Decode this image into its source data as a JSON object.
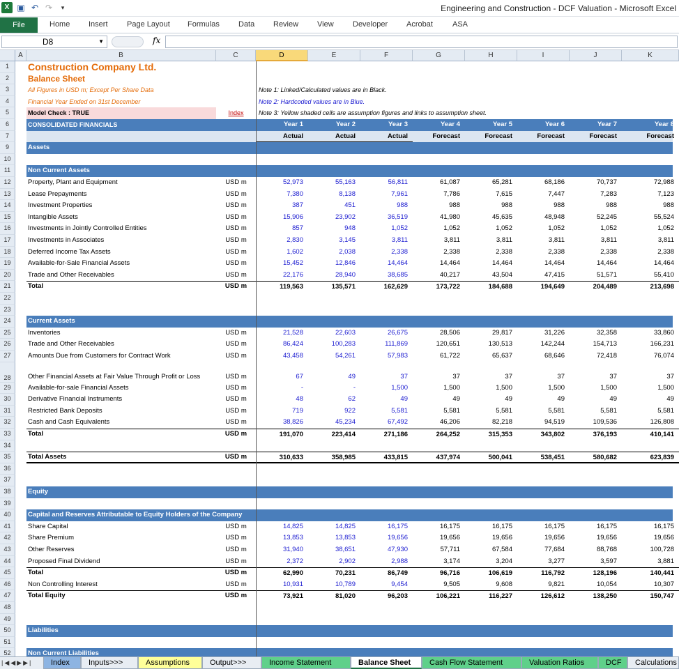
{
  "window": {
    "title": "Engineering and Construction - DCF Valuation - Microsoft Excel"
  },
  "ribbon": {
    "file": "File",
    "tabs": [
      "Home",
      "Insert",
      "Page Layout",
      "Formulas",
      "Data",
      "Review",
      "View",
      "Developer",
      "Acrobat",
      "ASA"
    ]
  },
  "formula_bar": {
    "name_box": "D8",
    "fx": "fx",
    "content": ""
  },
  "columns": [
    "A",
    "B",
    "C",
    "D",
    "E",
    "F",
    "G",
    "H",
    "I",
    "J",
    "K"
  ],
  "selected_column": "D",
  "rows": [
    {
      "n": "1",
      "type": "title",
      "b": "Construction Company Ltd."
    },
    {
      "n": "2",
      "type": "subtitle",
      "b": "Balance Sheet"
    },
    {
      "n": "3",
      "type": "note",
      "b": "All Figures in USD m; Except Per Share Data",
      "note": "Note 1: Linked/Calculated values are in Black."
    },
    {
      "n": "4",
      "type": "note2",
      "b": "Financial Year Ended on 31st December",
      "note": "Note 2: Hardcoded values are in Blue."
    },
    {
      "n": "5",
      "type": "check",
      "b": "Model Check : TRUE",
      "c": "Index",
      "note": "Note 3: Yellow shaded cells are assumption figures and links to assumption sheet."
    },
    {
      "n": "6",
      "type": "header",
      "b": "CONSOLIDATED FINANCIALS",
      "vals": [
        "Year 1",
        "Year 2",
        "Year 3",
        "Year 4",
        "Year 5",
        "Year 6",
        "Year 7",
        "Year 8"
      ]
    },
    {
      "n": "7",
      "type": "subheader",
      "vals": [
        "Actual",
        "Actual",
        "Actual",
        "Forecast",
        "Forecast",
        "Forecast",
        "Forecast",
        "Forecast"
      ]
    },
    {
      "n": "9",
      "type": "section",
      "b": "Assets"
    },
    {
      "n": "10",
      "type": "blank"
    },
    {
      "n": "11",
      "type": "section",
      "b": "Non Current Assets"
    },
    {
      "n": "12",
      "type": "data",
      "b": "Property, Plant and Equipment",
      "c": "USD m",
      "vals": [
        "52,973",
        "55,163",
        "56,811",
        "61,087",
        "65,281",
        "68,186",
        "70,737",
        "72,988"
      ]
    },
    {
      "n": "13",
      "type": "data",
      "b": "Lease Prepayments",
      "c": "USD m",
      "vals": [
        "7,380",
        "8,138",
        "7,961",
        "7,786",
        "7,615",
        "7,447",
        "7,283",
        "7,123"
      ]
    },
    {
      "n": "14",
      "type": "data",
      "b": "Investment Properties",
      "c": "USD m",
      "vals": [
        "387",
        "451",
        "988",
        "988",
        "988",
        "988",
        "988",
        "988"
      ]
    },
    {
      "n": "15",
      "type": "data",
      "b": "Intangible Assets",
      "c": "USD m",
      "vals": [
        "15,906",
        "23,902",
        "36,519",
        "41,980",
        "45,635",
        "48,948",
        "52,245",
        "55,524"
      ]
    },
    {
      "n": "16",
      "type": "data",
      "b": "Investments in Jointly Controlled Entities",
      "c": "USD m",
      "vals": [
        "857",
        "948",
        "1,052",
        "1,052",
        "1,052",
        "1,052",
        "1,052",
        "1,052"
      ]
    },
    {
      "n": "17",
      "type": "data",
      "b": "Investments in Associates",
      "c": "USD m",
      "vals": [
        "2,830",
        "3,145",
        "3,811",
        "3,811",
        "3,811",
        "3,811",
        "3,811",
        "3,811"
      ]
    },
    {
      "n": "18",
      "type": "data",
      "b": "Deferred Income Tax Assets",
      "c": "USD m",
      "vals": [
        "1,602",
        "2,038",
        "2,338",
        "2,338",
        "2,338",
        "2,338",
        "2,338",
        "2,338"
      ]
    },
    {
      "n": "19",
      "type": "data",
      "b": "Available-for-Sale Financial Assets",
      "c": "USD m",
      "vals": [
        "15,452",
        "12,846",
        "14,464",
        "14,464",
        "14,464",
        "14,464",
        "14,464",
        "14,464"
      ]
    },
    {
      "n": "20",
      "type": "data",
      "b": "Trade and Other Receivables",
      "c": "USD m",
      "vals": [
        "22,176",
        "28,940",
        "38,685",
        "40,217",
        "43,504",
        "47,415",
        "51,571",
        "55,410"
      ]
    },
    {
      "n": "21",
      "type": "total",
      "b": "Total",
      "c": "USD m",
      "vals": [
        "119,563",
        "135,571",
        "162,629",
        "173,722",
        "184,688",
        "194,649",
        "204,489",
        "213,698"
      ]
    },
    {
      "n": "22",
      "type": "blank"
    },
    {
      "n": "23",
      "type": "blank"
    },
    {
      "n": "24",
      "type": "section",
      "b": "Current Assets"
    },
    {
      "n": "25",
      "type": "data",
      "b": "Inventories",
      "c": "USD m",
      "vals": [
        "21,528",
        "22,603",
        "26,675",
        "28,506",
        "29,817",
        "31,226",
        "32,358",
        "33,860"
      ]
    },
    {
      "n": "26",
      "type": "data",
      "b": "Trade and Other Receivables",
      "c": "USD m",
      "vals": [
        "86,424",
        "100,283",
        "111,869",
        "120,651",
        "130,513",
        "142,244",
        "154,713",
        "166,231"
      ]
    },
    {
      "n": "27",
      "type": "data",
      "b": "Amounts Due from Customers for Contract Work",
      "c": "USD m",
      "vals": [
        "43,458",
        "54,261",
        "57,983",
        "61,722",
        "65,637",
        "68,646",
        "72,418",
        "76,074"
      ]
    },
    {
      "n": "28",
      "type": "data",
      "tall": true,
      "b": "Other Financial Assets at Fair Value Through Profit or Loss",
      "c": "USD m",
      "vals": [
        "67",
        "49",
        "37",
        "37",
        "37",
        "37",
        "37",
        "37"
      ]
    },
    {
      "n": "29",
      "type": "data",
      "b": "Available-for-sale Financial Assets",
      "c": "USD m",
      "vals": [
        "-",
        "-",
        "1,500",
        "1,500",
        "1,500",
        "1,500",
        "1,500",
        "1,500"
      ]
    },
    {
      "n": "30",
      "type": "data",
      "b": "Derivative Financial Instruments",
      "c": "USD m",
      "vals": [
        "48",
        "62",
        "49",
        "49",
        "49",
        "49",
        "49",
        "49"
      ]
    },
    {
      "n": "31",
      "type": "data",
      "b": "Restricted Bank Deposits",
      "c": "USD m",
      "vals": [
        "719",
        "922",
        "5,581",
        "5,581",
        "5,581",
        "5,581",
        "5,581",
        "5,581"
      ]
    },
    {
      "n": "32",
      "type": "data",
      "b": "Cash and Cash Equivalents",
      "c": "USD m",
      "vals": [
        "38,826",
        "45,234",
        "67,492",
        "46,206",
        "82,218",
        "94,519",
        "109,536",
        "126,808"
      ]
    },
    {
      "n": "33",
      "type": "total",
      "b": "Total",
      "c": "USD m",
      "vals": [
        "191,070",
        "223,414",
        "271,186",
        "264,252",
        "315,353",
        "343,802",
        "376,193",
        "410,141"
      ]
    },
    {
      "n": "34",
      "type": "blank"
    },
    {
      "n": "35",
      "type": "grand",
      "b": "Total Assets",
      "c": "USD m",
      "vals": [
        "310,633",
        "358,985",
        "433,815",
        "437,974",
        "500,041",
        "538,451",
        "580,682",
        "623,839"
      ]
    },
    {
      "n": "36",
      "type": "blank"
    },
    {
      "n": "37",
      "type": "blank"
    },
    {
      "n": "38",
      "type": "section",
      "b": "Equity"
    },
    {
      "n": "39",
      "type": "blank"
    },
    {
      "n": "40",
      "type": "section",
      "b": "Capital and Reserves Attributable to Equity Holders of the Company"
    },
    {
      "n": "41",
      "type": "data",
      "b": "Share Capital",
      "c": "USD m",
      "vals": [
        "14,825",
        "14,825",
        "16,175",
        "16,175",
        "16,175",
        "16,175",
        "16,175",
        "16,175"
      ]
    },
    {
      "n": "42",
      "type": "data",
      "b": "Share Premium",
      "c": "USD m",
      "vals": [
        "13,853",
        "13,853",
        "19,656",
        "19,656",
        "19,656",
        "19,656",
        "19,656",
        "19,656"
      ]
    },
    {
      "n": "43",
      "type": "data",
      "b": "Other Reserves",
      "c": "USD m",
      "vals": [
        "31,940",
        "38,651",
        "47,930",
        "57,711",
        "67,584",
        "77,684",
        "88,768",
        "100,728"
      ]
    },
    {
      "n": "44",
      "type": "data",
      "b": "Proposed Final Dividend",
      "c": "USD m",
      "vals": [
        "2,372",
        "2,902",
        "2,988",
        "3,174",
        "3,204",
        "3,277",
        "3,597",
        "3,881"
      ]
    },
    {
      "n": "45",
      "type": "total",
      "b": "Total",
      "c": "USD m",
      "vals": [
        "62,990",
        "70,231",
        "86,749",
        "96,716",
        "106,619",
        "116,792",
        "128,196",
        "140,441"
      ]
    },
    {
      "n": "46",
      "type": "data",
      "b": "Non Controlling Interest",
      "c": "USD m",
      "vals": [
        "10,931",
        "10,789",
        "9,454",
        "9,505",
        "9,608",
        "9,821",
        "10,054",
        "10,307"
      ]
    },
    {
      "n": "47",
      "type": "total",
      "b": "Total Equity",
      "c": "USD m",
      "vals": [
        "73,921",
        "81,020",
        "96,203",
        "106,221",
        "116,227",
        "126,612",
        "138,250",
        "150,747"
      ]
    },
    {
      "n": "48",
      "type": "blank"
    },
    {
      "n": "49",
      "type": "blank"
    },
    {
      "n": "50",
      "type": "section",
      "b": "Liabilities"
    },
    {
      "n": "51",
      "type": "blank"
    },
    {
      "n": "52",
      "type": "section",
      "b": "Non Current Liabilities"
    }
  ],
  "sheet_tabs": [
    {
      "label": "Index",
      "bg": "#8db4e2",
      "active": false
    },
    {
      "label": "Inputs>>>",
      "bg": "#e8edf3",
      "active": false
    },
    {
      "label": "Assumptions",
      "bg": "#ffff99",
      "active": false
    },
    {
      "label": "Output>>>",
      "bg": "#e8edf3",
      "active": false
    },
    {
      "label": "Income Statement",
      "bg": "#5fd08a",
      "active": false
    },
    {
      "label": "Balance Sheet",
      "bg": "#ffffff",
      "active": true
    },
    {
      "label": "Cash Flow Statement",
      "bg": "#5fd08a",
      "active": false
    },
    {
      "label": "Valuation Ratios",
      "bg": "#5fd08a",
      "active": false
    },
    {
      "label": "DCF",
      "bg": "#5fd08a",
      "active": false
    },
    {
      "label": "Calculations",
      "bg": "#e8edf3",
      "active": false
    }
  ],
  "colors": {
    "accent_orange": "#e46c0a",
    "header_blue": "#4a7ebb",
    "hardcode_blue": "#1a1ad0",
    "excel_green": "#207245"
  }
}
